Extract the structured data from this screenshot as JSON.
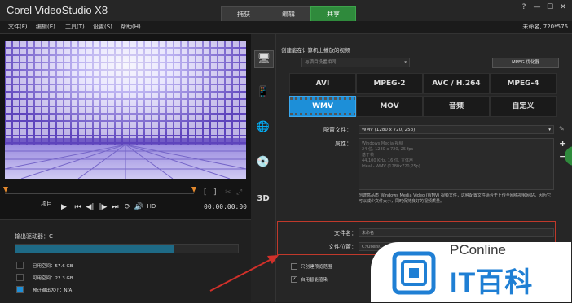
{
  "app": {
    "title": "Corel  VideoStudio X8",
    "project_info": "未命名, 720*576"
  },
  "mode_tabs": [
    {
      "label": "捕获",
      "active": false
    },
    {
      "label": "编辑",
      "active": false
    },
    {
      "label": "共享",
      "active": true
    }
  ],
  "window_buttons": [
    "?",
    "—",
    "☐",
    "✕"
  ],
  "menu": [
    "文件(F)",
    "编辑(E)",
    "工具(T)",
    "设置(S)",
    "帮助(H)"
  ],
  "player": {
    "project_label": "项目",
    "brackets": [
      "[",
      "]"
    ],
    "controls": [
      "▶",
      "⏮",
      "◀|",
      "|▶",
      "⏭",
      "⟳",
      "🔊",
      "HD"
    ],
    "timecode": "00:00:00:00"
  },
  "drive": {
    "label": "输出驱动器：C",
    "used_fraction": 0.71,
    "items": [
      {
        "label": "已用空间：57.6 GB",
        "color": "#1b1b1b"
      },
      {
        "label": "可用空间：22.3 GB",
        "color": "#1b1b1b"
      },
      {
        "label": "预计输出大小：N/A",
        "color": "#1e8fd8"
      }
    ]
  },
  "side_icons": [
    "monitor-icon",
    "phone-icon",
    "globe-icon",
    "disc-icon",
    "3d-icon"
  ],
  "share": {
    "section_title": "创建能在计算机上播放的视频",
    "dropdown_placeholder": "与项目设置相同",
    "mpeg_opt_label": "MPEG 优化器",
    "formats": [
      [
        "AVI",
        "MPEG-2",
        "AVC / H.264",
        "MPEG-4"
      ],
      [
        "WMV",
        "MOV",
        "音频",
        "自定义"
      ]
    ],
    "active_format": "WMV",
    "profile_label": "配置文件：",
    "profile_value": "WMV (1280 x 720, 25p)",
    "props_label": "属性：",
    "props_lines": [
      "Windows Media 视频",
      "24 位, 1280 x 720, 25 fps",
      "基于帧",
      "44,100 KHz, 16 位, 立体声",
      "Ideal - WMV (1280x720,25p)"
    ],
    "description": "创建高品质 Windows Media Video (WMV) 视频文件，这种配置文件适合于上传至网络视频网站，因为它可以减少文件大小，同时保持良好的视频质量。",
    "filename_label": "文件名：",
    "filename_value": "未命名",
    "location_label": "文件位置：",
    "location_value": "C:\\Users\\...",
    "checkboxes": [
      {
        "label": "只创建预览范围",
        "checked": false
      },
      {
        "label": "启用智能渲染",
        "checked": true
      }
    ]
  },
  "watermark": {
    "line1": "PConline",
    "line2": "IT百科"
  }
}
